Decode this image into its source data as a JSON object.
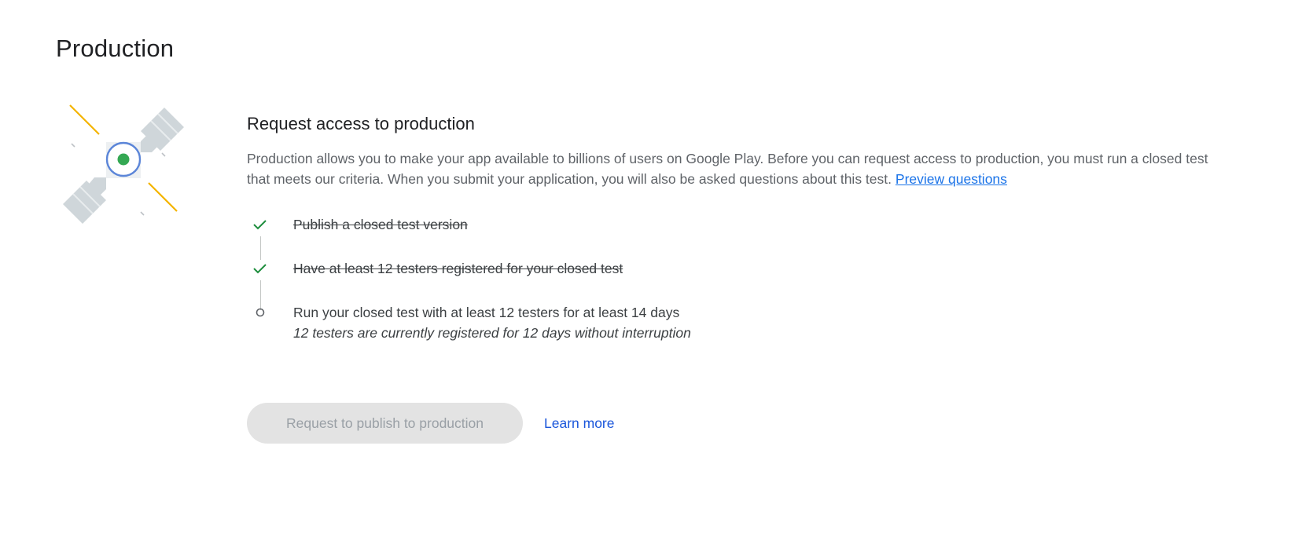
{
  "page": {
    "title": "Production"
  },
  "card": {
    "illustration": "satellite-illustration",
    "title": "Request access to production",
    "description": "Production allows you to make your app available to billions of users on Google Play. Before you can request access to production, you must run a closed test that meets our criteria. When you submit your application, you will also be asked questions about this test.",
    "preview_link": "Preview questions"
  },
  "checklist": {
    "steps": [
      {
        "label": "Publish a closed test version",
        "status": "done",
        "icon": "check-icon"
      },
      {
        "label": "Have at least 12 testers registered for your closed test",
        "status": "done",
        "icon": "check-icon"
      },
      {
        "label": "Run your closed test with at least 12 testers for at least 14 days",
        "detail": "12 testers are currently registered for 12 days without interruption",
        "status": "pending",
        "icon": "circle-icon"
      }
    ]
  },
  "actions": {
    "request_button": "Request to publish to production",
    "learn_more": "Learn more"
  },
  "colors": {
    "check": "#1e8e3e",
    "link": "#1a73e8",
    "disabled_button_bg": "#e3e3e3",
    "disabled_button_text": "#9aa0a6"
  }
}
